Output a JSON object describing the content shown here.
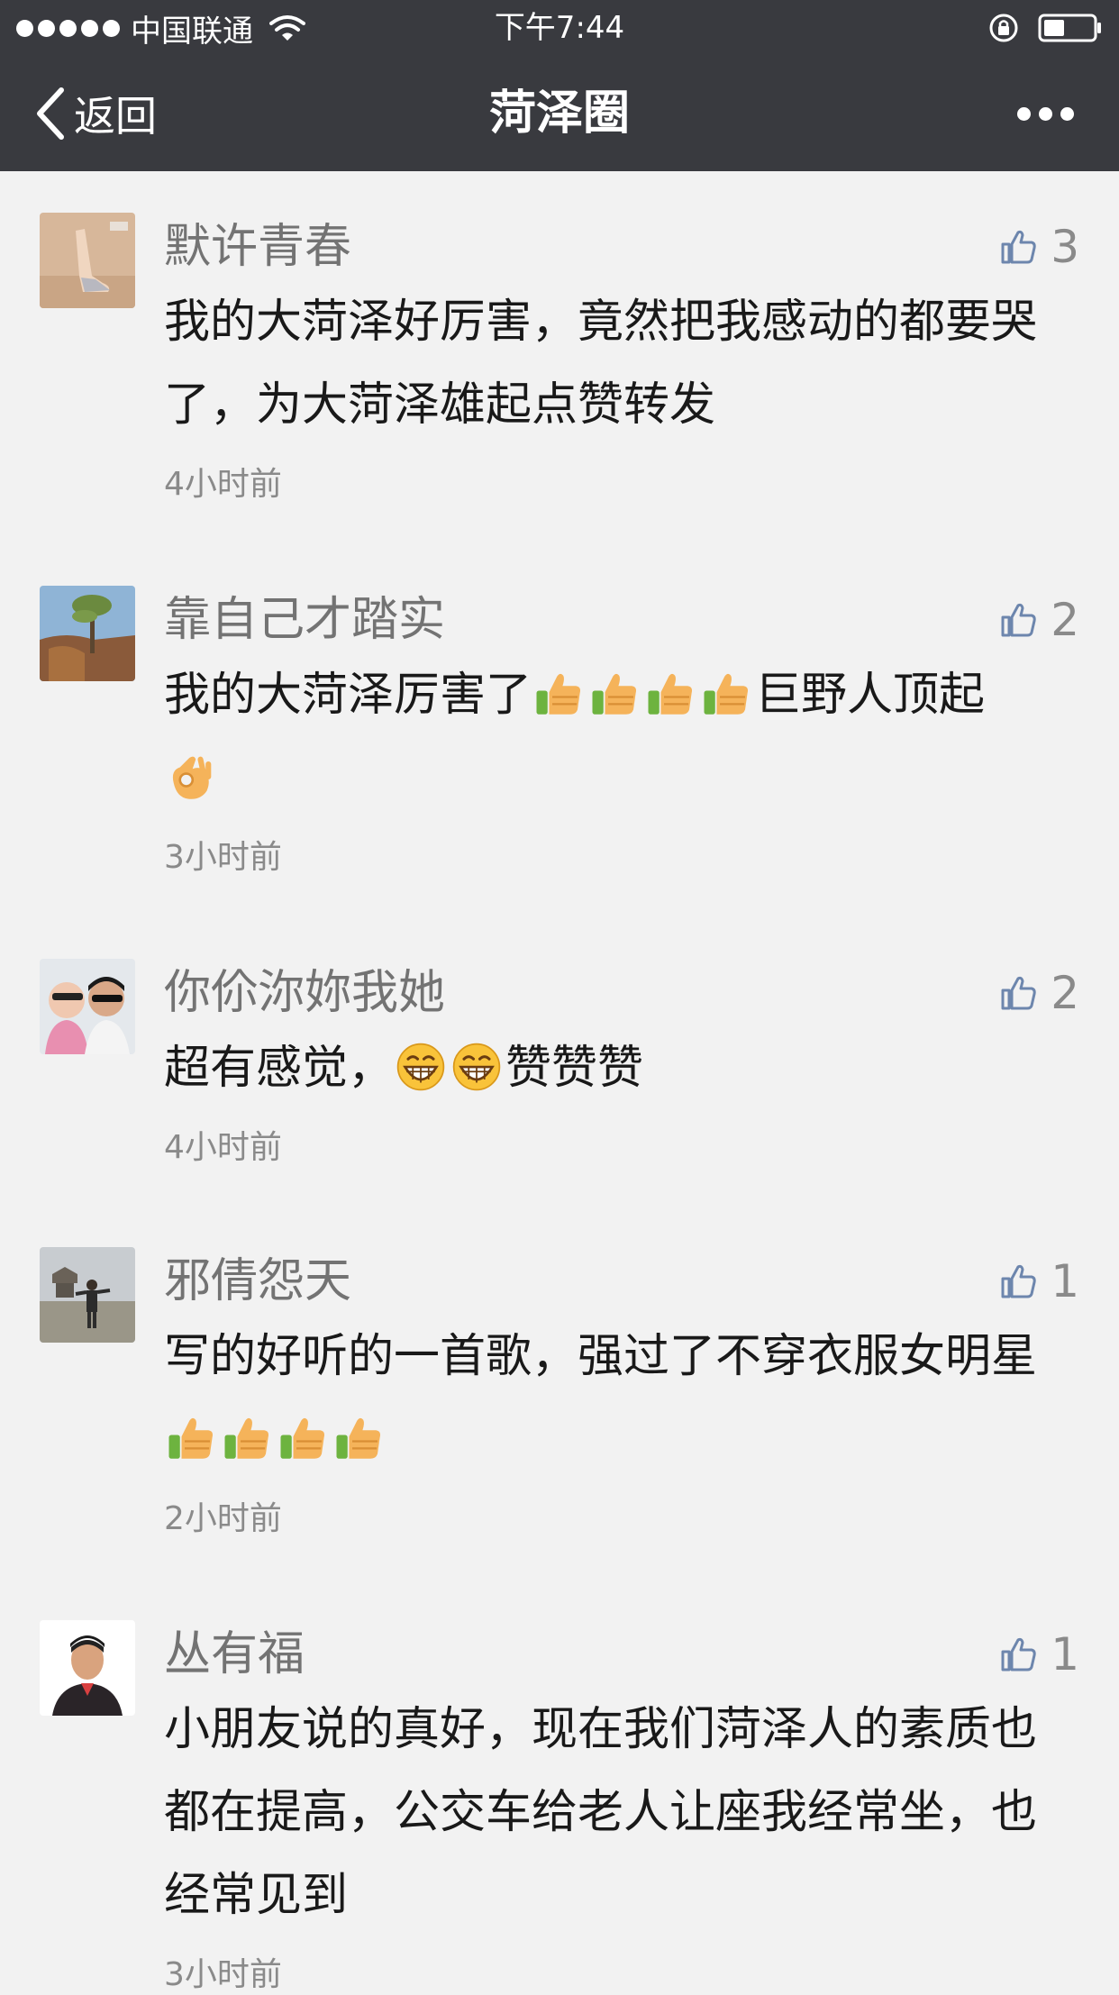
{
  "status_bar": {
    "carrier": "中国联通",
    "time": "下午7:44"
  },
  "nav": {
    "back_label": "返回",
    "title": "菏泽圈"
  },
  "comments": [
    {
      "author": "默许青春",
      "likes": "3",
      "text": "我的大菏泽好厉害，竟然把我感动的都要哭了，为大菏泽雄起点赞转发",
      "time": "4小时前"
    },
    {
      "author": "靠自己才踏实",
      "likes": "2",
      "text_part1": "我的大菏泽厉害了",
      "text_part2": "巨野人顶起",
      "time": "3小时前"
    },
    {
      "author": "你伱沵妳我她",
      "likes": "2",
      "text_part1": "超有感觉，",
      "text_part2": "赞赞赞",
      "time": "4小时前"
    },
    {
      "author": "邪倩怨天",
      "likes": "1",
      "text_part1": "写的好听的一首歌，强过了不穿衣服女明星",
      "time": "2小时前"
    },
    {
      "author": "丛有福",
      "likes": "1",
      "text": "小朋友说的真好，现在我们菏泽人的素质也都在提高，公交车给老人让座我经常坐，也经常见到",
      "time": "3小时前"
    }
  ]
}
